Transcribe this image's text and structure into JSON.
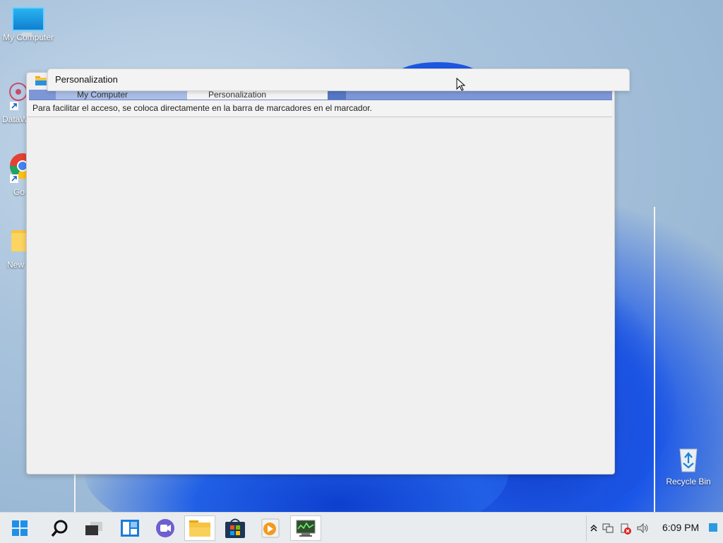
{
  "desktop": {
    "icons": [
      {
        "label": "My Computer"
      },
      {
        "label": "DataW"
      },
      {
        "label": "Go Chr"
      },
      {
        "label": "New"
      },
      {
        "label": "Recycle Bin"
      }
    ]
  },
  "explorer": {
    "tabs": [
      {
        "label": "My Computer"
      },
      {
        "label": "Personalization"
      }
    ],
    "infobar_text": "Para facilitar el acceso, se coloca directamente en la barra de marcadores en el marcador."
  },
  "personalization_window": {
    "title": "Personalization"
  },
  "taskbar": {
    "buttons": [
      {
        "icon": "windows-start-icon"
      },
      {
        "icon": "search-icon"
      },
      {
        "icon": "task-view-icon"
      },
      {
        "icon": "widgets-icon"
      },
      {
        "icon": "teams-chat-icon"
      },
      {
        "icon": "file-explorer-icon"
      },
      {
        "icon": "microsoft-store-icon"
      },
      {
        "icon": "media-player-icon"
      },
      {
        "icon": "task-manager-icon"
      }
    ],
    "clock": "6:09 PM"
  }
}
